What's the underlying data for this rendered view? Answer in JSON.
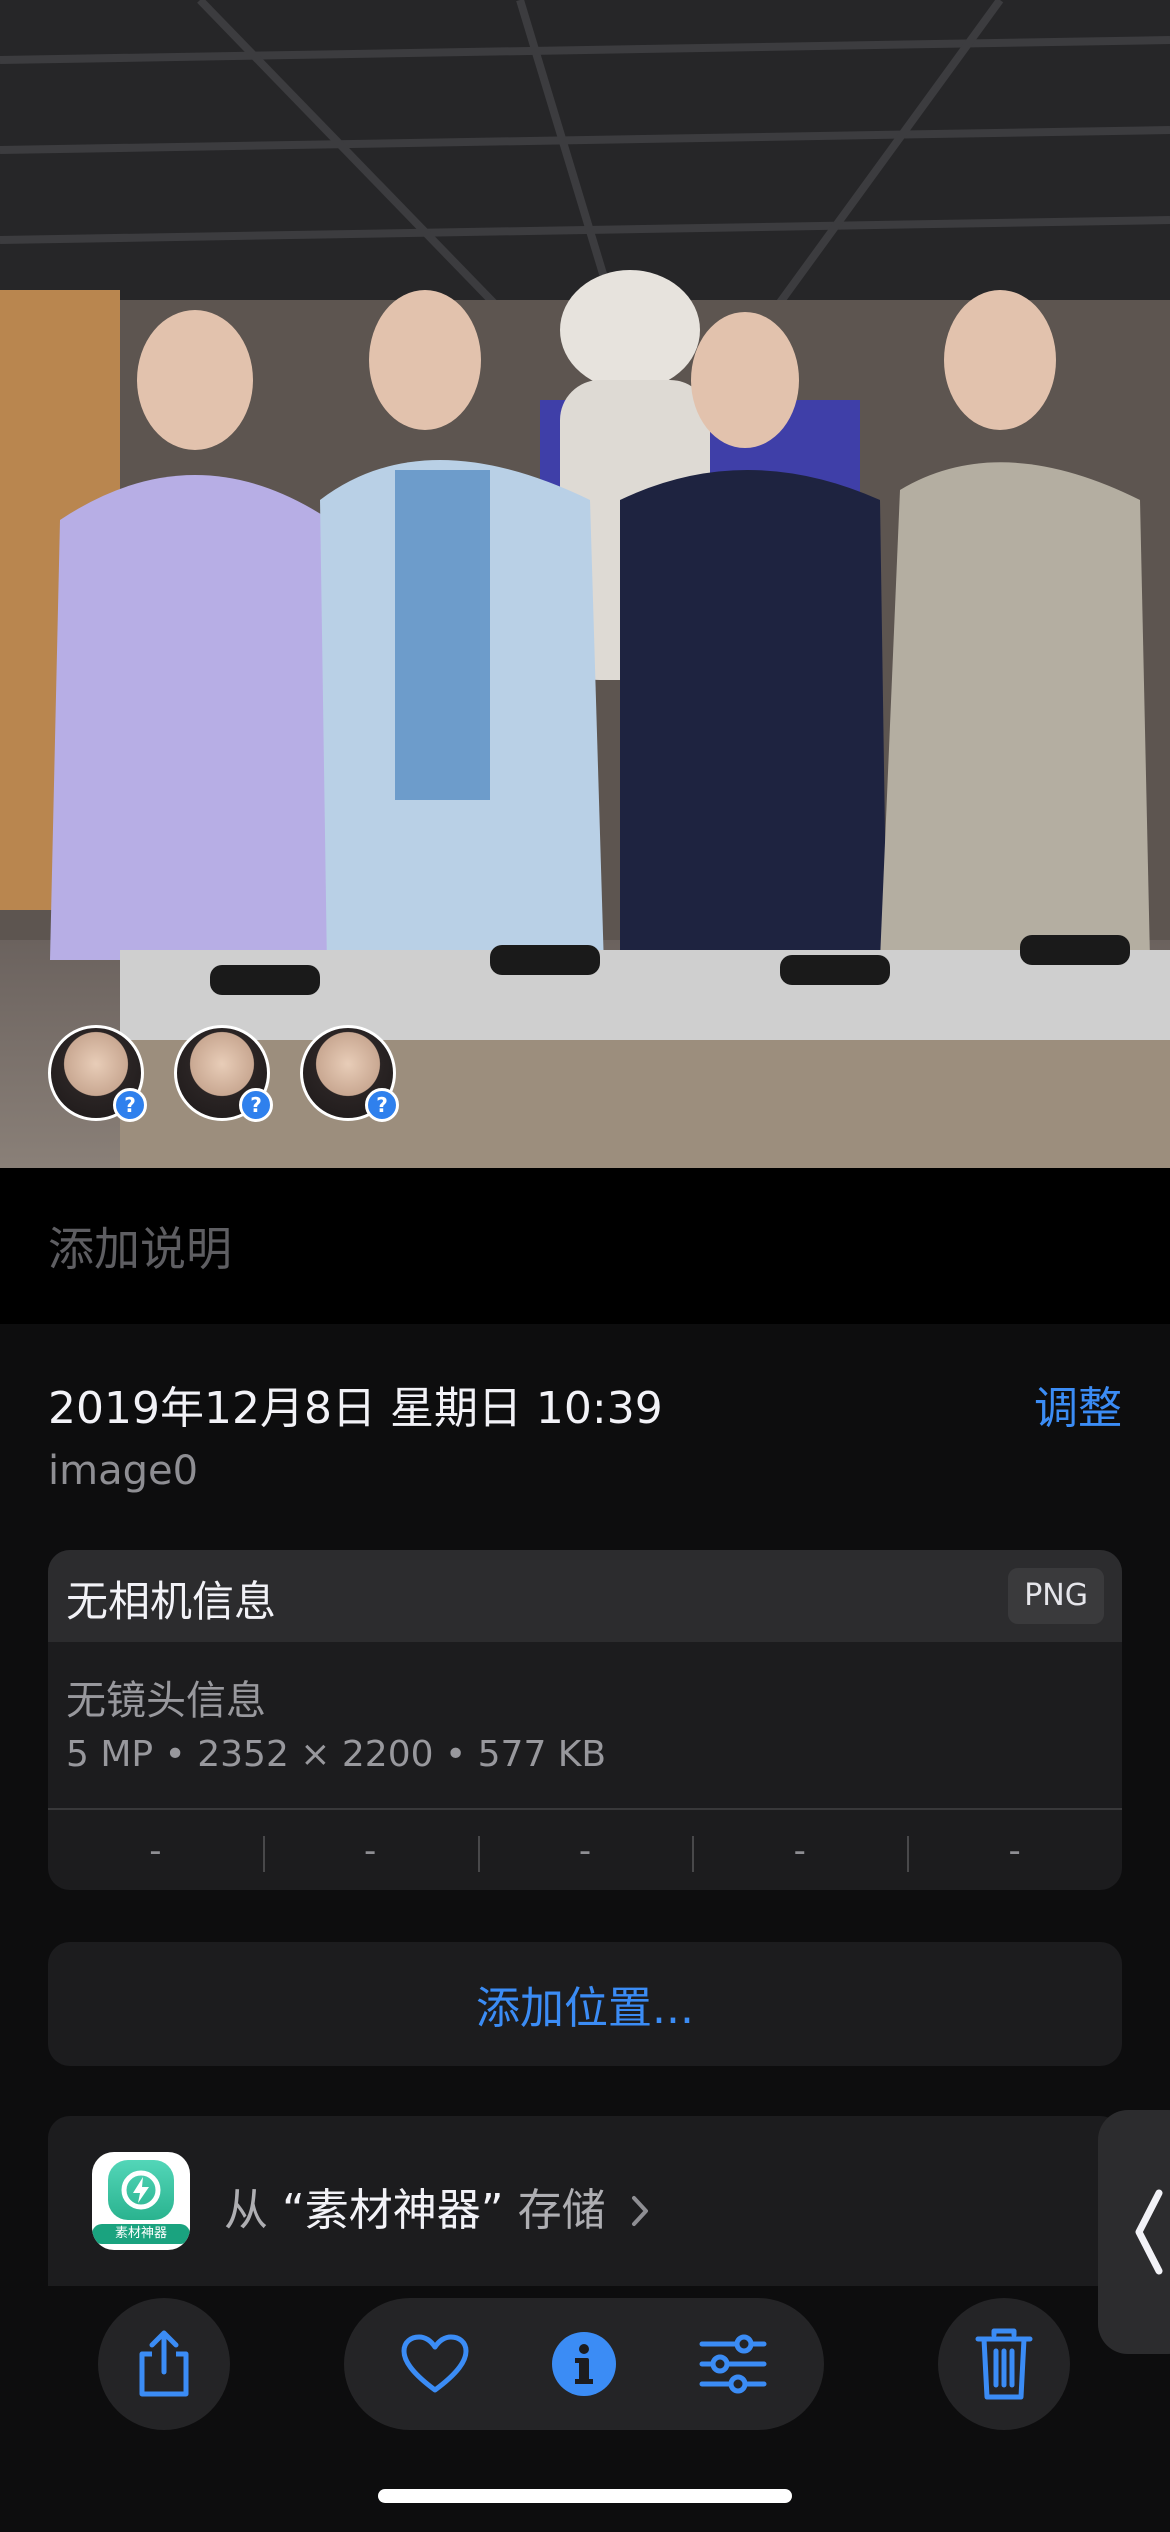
{
  "photo": {
    "faces": [
      {
        "badge": "?"
      },
      {
        "badge": "?"
      },
      {
        "badge": "?"
      }
    ]
  },
  "caption": {
    "placeholder": "添加说明"
  },
  "info": {
    "datetime": "2019年12月8日 星期日 10:39",
    "adjust_label": "调整",
    "filename": "image0",
    "camera_title": "无相机信息",
    "format_badge": "PNG",
    "lens": "无镜头信息",
    "specs": "5 MP • 2352 × 2200 • 577 KB",
    "exif": [
      "-",
      "-",
      "-",
      "-",
      "-"
    ]
  },
  "location": {
    "add_label": "添加位置..."
  },
  "save": {
    "prefix": "从",
    "app_name": "“素材神器”",
    "suffix": "存储",
    "app_icon_label": "素材神器"
  },
  "toolbar": {
    "share": "share-icon",
    "favorite": "heart-icon",
    "info": "info-icon",
    "edit": "adjust-icon",
    "delete": "trash-icon"
  },
  "colors": {
    "accent": "#3b8cf5",
    "background": "#000000",
    "card": "#1c1c1e"
  }
}
